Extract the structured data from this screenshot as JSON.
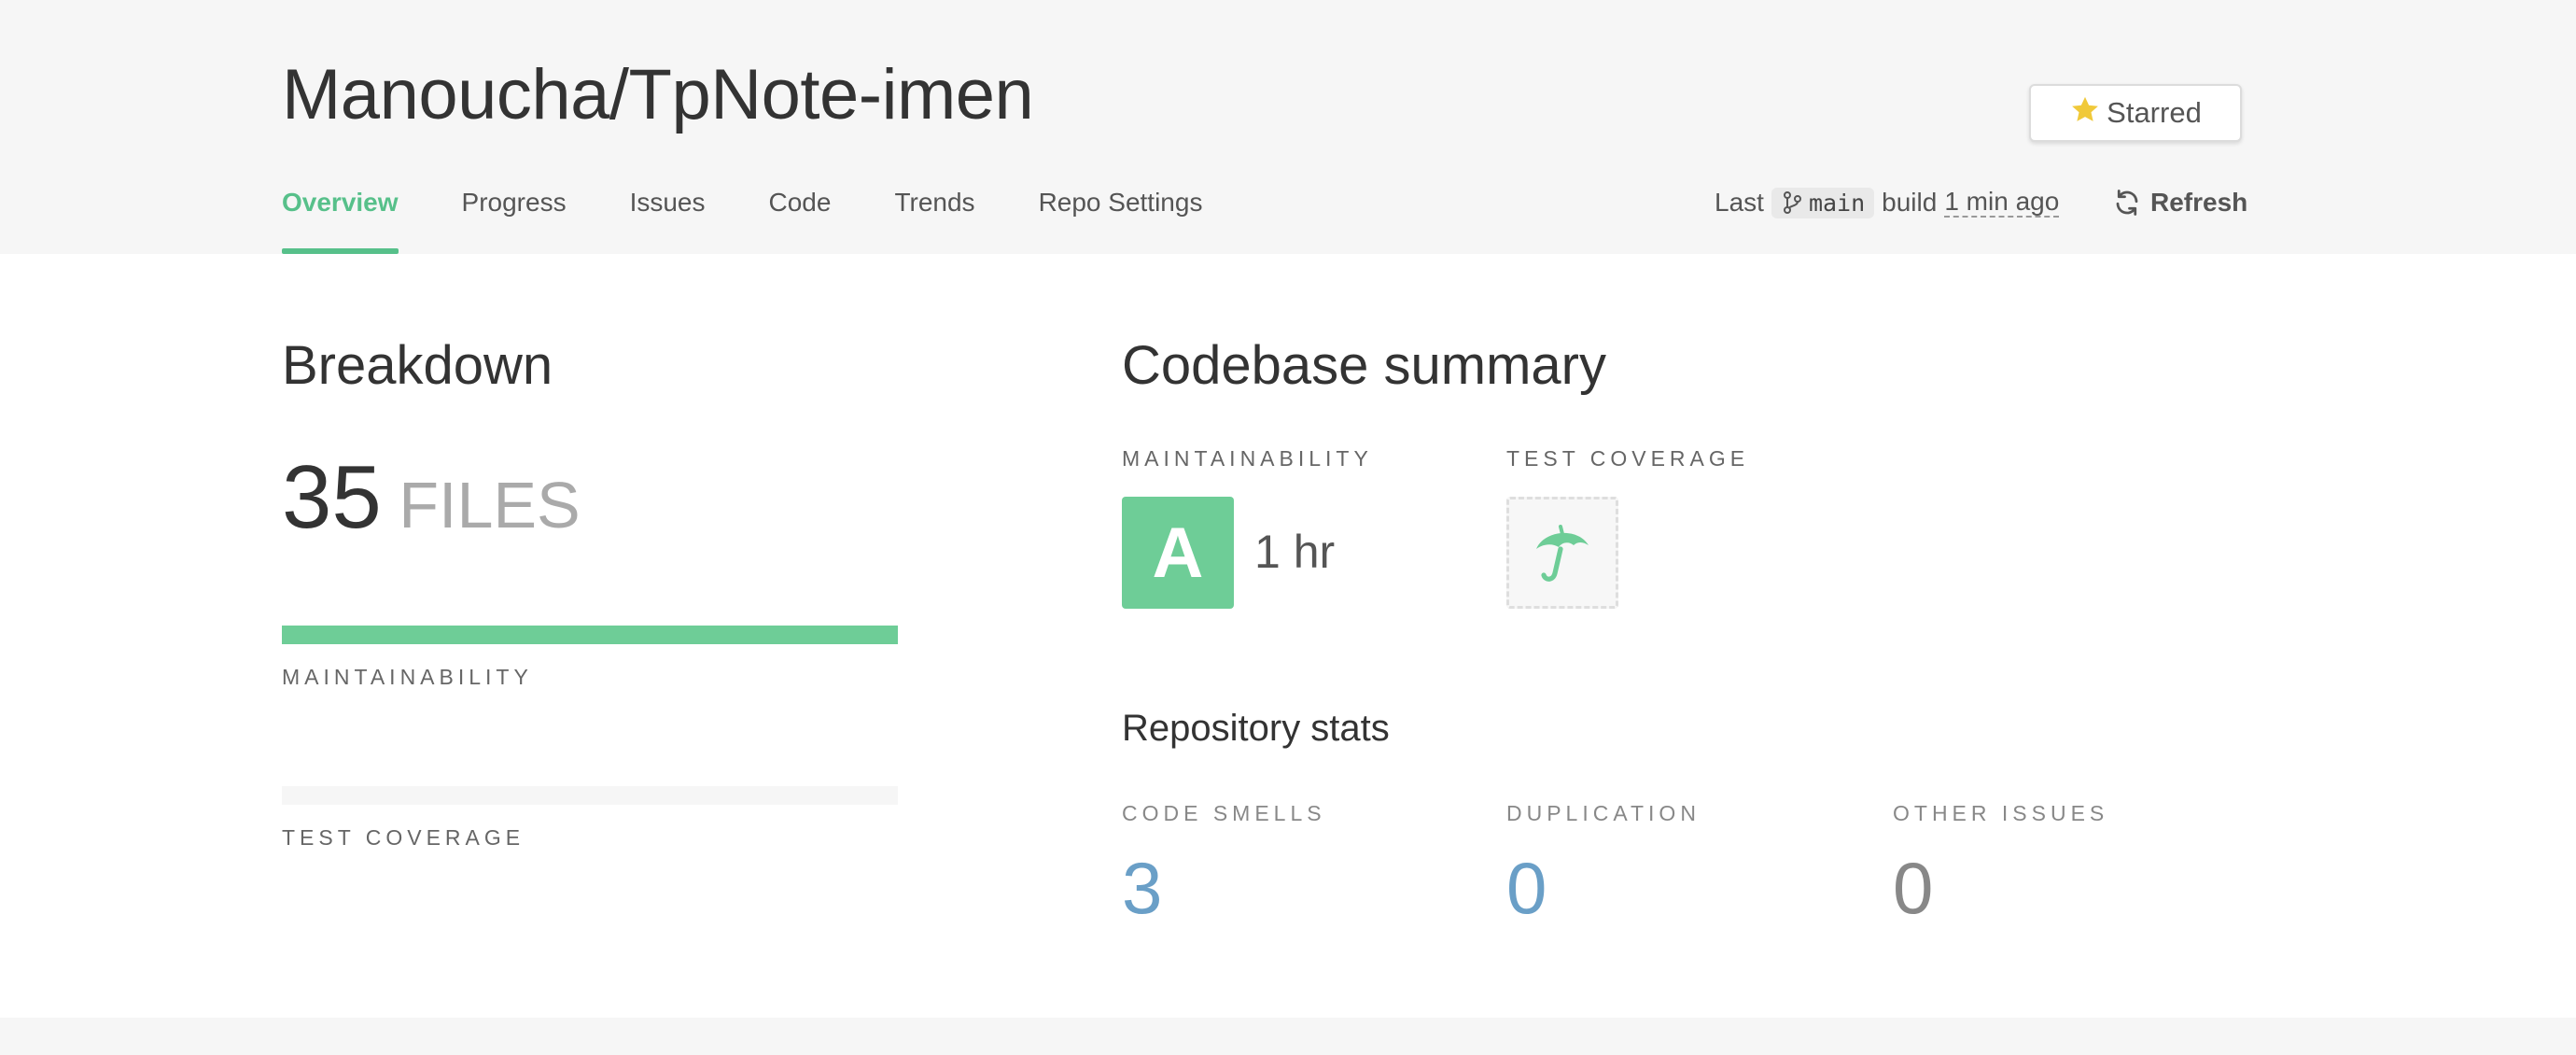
{
  "header": {
    "repo_title": "Manoucha/TpNote-imen",
    "star_label": "Starred",
    "tabs": [
      {
        "label": "Overview",
        "active": true
      },
      {
        "label": "Progress",
        "active": false
      },
      {
        "label": "Issues",
        "active": false
      },
      {
        "label": "Code",
        "active": false
      },
      {
        "label": "Trends",
        "active": false
      },
      {
        "label": "Repo Settings",
        "active": false
      }
    ],
    "build": {
      "prefix": "Last",
      "branch": "main",
      "middle": "build",
      "time": "1 min ago"
    },
    "refresh_label": "Refresh"
  },
  "breakdown": {
    "title": "Breakdown",
    "file_count": "35",
    "file_unit": "FILES",
    "maintainability_label": "MAINTAINABILITY",
    "test_coverage_label": "TEST COVERAGE"
  },
  "summary": {
    "title": "Codebase summary",
    "maintainability_label": "MAINTAINABILITY",
    "maintainability_grade": "A",
    "maintainability_time": "1 hr",
    "test_coverage_label": "TEST COVERAGE",
    "stats_title": "Repository stats",
    "stats": [
      {
        "label": "CODE SMELLS",
        "value": "3",
        "color": "#6a9fc7"
      },
      {
        "label": "DUPLICATION",
        "value": "0",
        "color": "#6a9fc7"
      },
      {
        "label": "OTHER ISSUES",
        "value": "0",
        "color": "#888888"
      }
    ]
  },
  "colors": {
    "accent": "#57c08a",
    "grade_a": "#6ecd97",
    "star": "#f0c93a"
  },
  "icons": {
    "star": "star-icon",
    "branch": "git-branch-icon",
    "refresh": "refresh-icon",
    "umbrella": "umbrella-icon"
  }
}
